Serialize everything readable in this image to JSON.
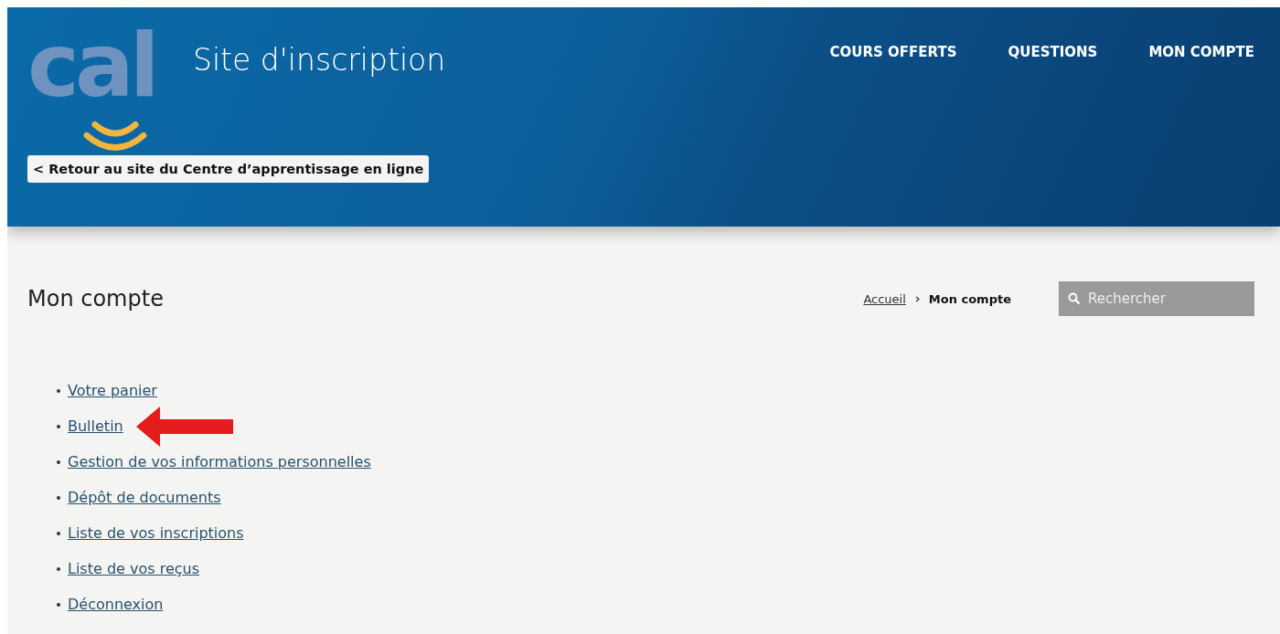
{
  "header": {
    "logo_text": "cal",
    "site_title": "Site d'inscription",
    "back_link": "< Retour au site du Centre d’apprentissage en ligne",
    "nav": [
      {
        "label": "COURS OFFERTS"
      },
      {
        "label": "QUESTIONS"
      },
      {
        "label": "MON COMPTE"
      }
    ]
  },
  "page": {
    "title": "Mon compte",
    "breadcrumb": [
      {
        "label": "Accueil",
        "kind": "link"
      },
      {
        "label": "Mon compte",
        "kind": "current"
      }
    ],
    "search": {
      "placeholder": "Rechercher"
    },
    "links": [
      {
        "label": "Votre panier",
        "highlighted": false
      },
      {
        "label": "Bulletin",
        "highlighted": true
      },
      {
        "label": "Gestion de vos informations personnelles",
        "highlighted": false
      },
      {
        "label": "Dépôt de documents",
        "highlighted": false
      },
      {
        "label": "Liste de vos inscriptions",
        "highlighted": false
      },
      {
        "label": "Liste de vos reçus",
        "highlighted": false
      },
      {
        "label": "Déconnexion",
        "highlighted": false
      }
    ]
  }
}
